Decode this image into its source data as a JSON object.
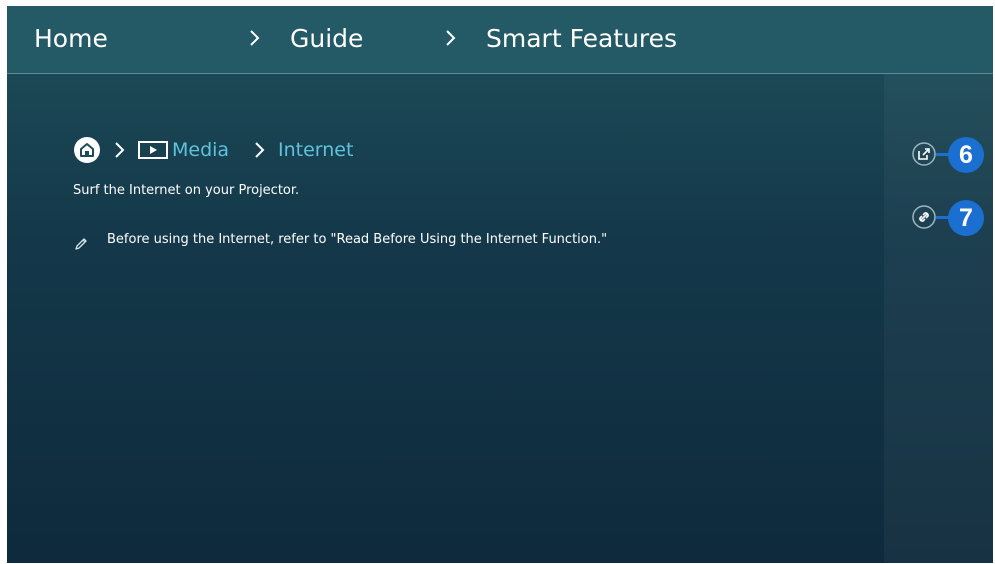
{
  "breadcrumb": {
    "items": [
      "Home",
      "Guide",
      "Smart Features"
    ]
  },
  "content": {
    "path": {
      "home_icon": "home-icon",
      "media_icon": "media-icon",
      "media_label": "Media",
      "internet_label": "Internet"
    },
    "description": "Surf the Internet on your Projector.",
    "note_icon": "pencil-icon",
    "note": "Before using the Internet, refer to \"Read Before Using the Internet Function.\""
  },
  "side_actions": [
    {
      "icon": "external-link-icon",
      "badge": "6"
    },
    {
      "icon": "link-icon",
      "badge": "7"
    }
  ],
  "colors": {
    "accent_blue": "#1a6fd1",
    "link_text": "#5ec3dd",
    "header_bg": "#245966"
  }
}
